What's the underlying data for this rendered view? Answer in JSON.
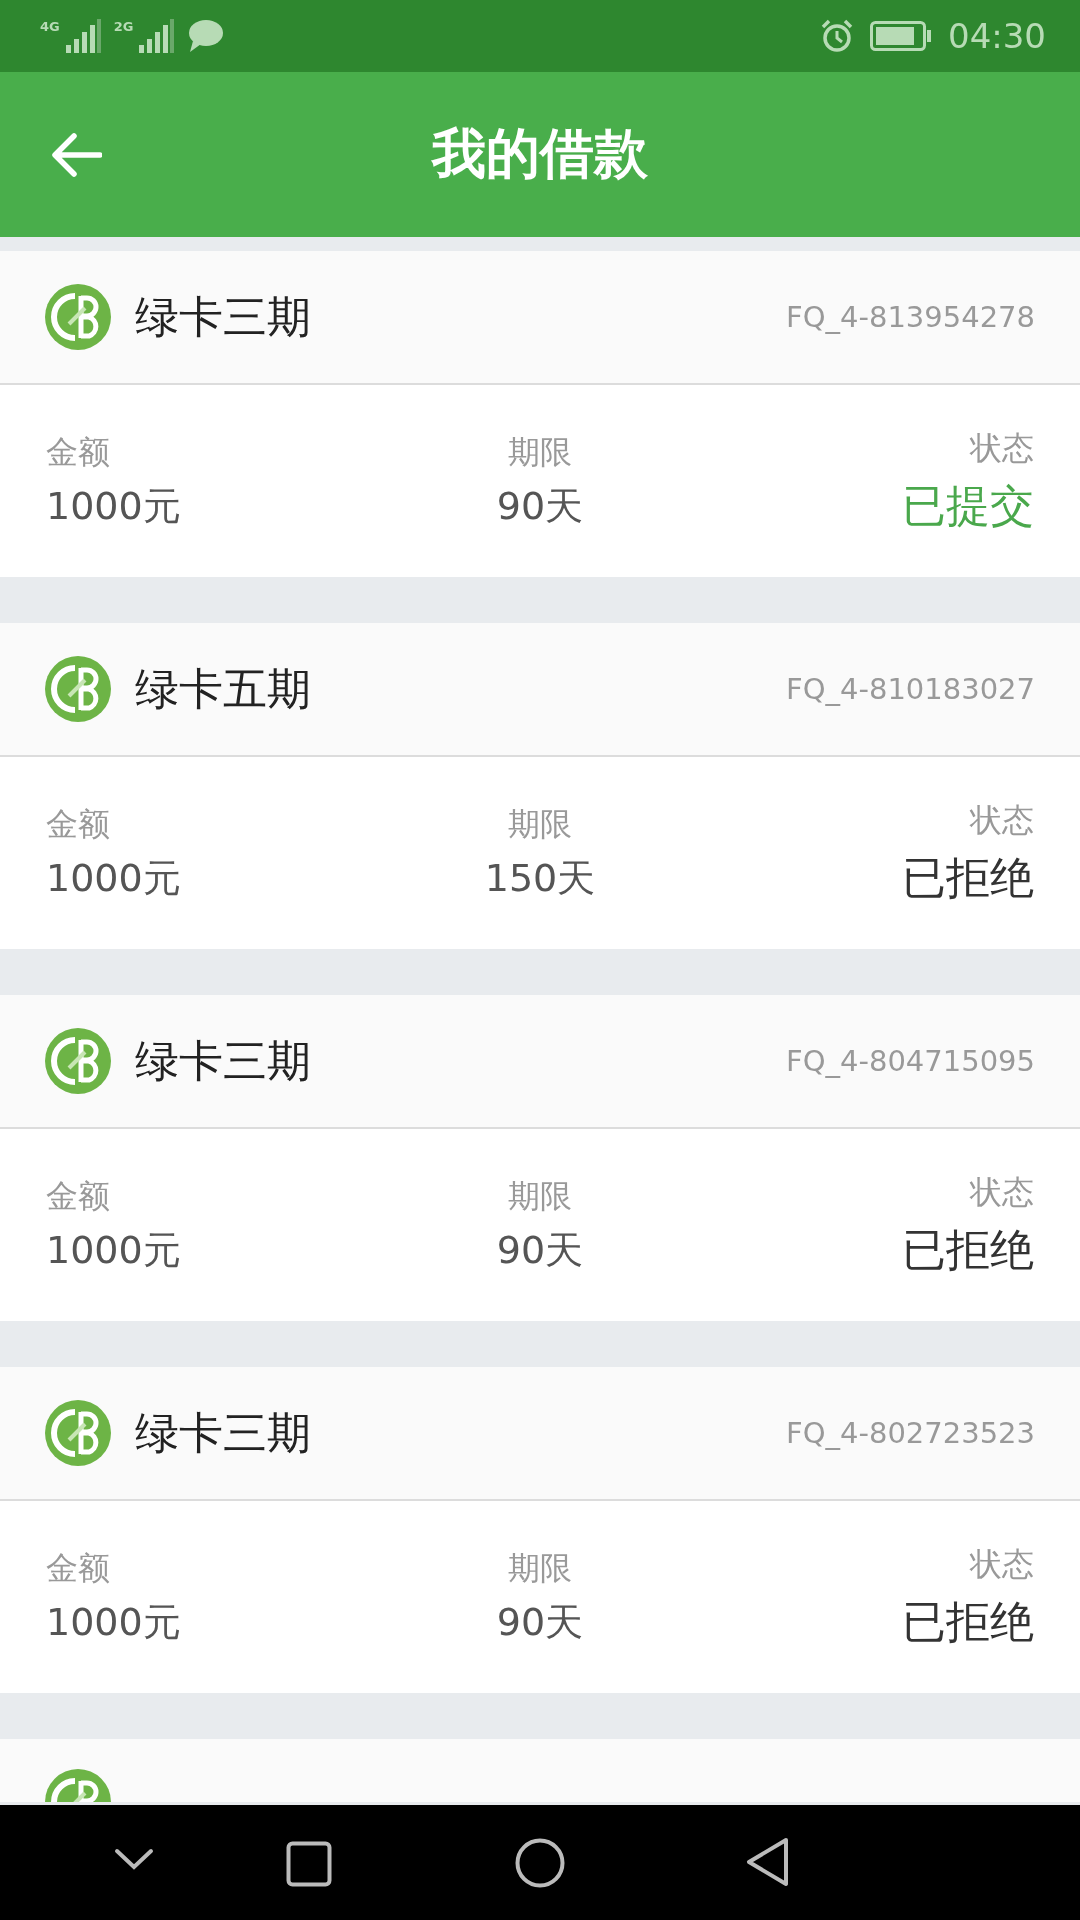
{
  "status_bar": {
    "network_1": "4G",
    "network_2": "2G",
    "time": "04:30"
  },
  "header": {
    "title": "我的借款"
  },
  "loans": [
    {
      "name": "绿卡三期",
      "number": "FQ_4-813954278",
      "amount_label": "金额",
      "amount": "1000元",
      "term_label": "期限",
      "term": "90天",
      "status_label": "状态",
      "status": "已提交",
      "kind": "submitted"
    },
    {
      "name": "绿卡五期",
      "number": "FQ_4-810183027",
      "amount_label": "金额",
      "amount": "1000元",
      "term_label": "期限",
      "term": "150天",
      "status_label": "状态",
      "status": "已拒绝",
      "kind": "rejected"
    },
    {
      "name": "绿卡三期",
      "number": "FQ_4-804715095",
      "amount_label": "金额",
      "amount": "1000元",
      "term_label": "期限",
      "term": "90天",
      "status_label": "状态",
      "status": "已拒绝",
      "kind": "rejected"
    },
    {
      "name": "绿卡三期",
      "number": "FQ_4-802723523",
      "amount_label": "金额",
      "amount": "1000元",
      "term_label": "期限",
      "term": "90天",
      "status_label": "状态",
      "status": "已拒绝",
      "kind": "rejected"
    },
    {
      "kind": "partial"
    }
  ]
}
